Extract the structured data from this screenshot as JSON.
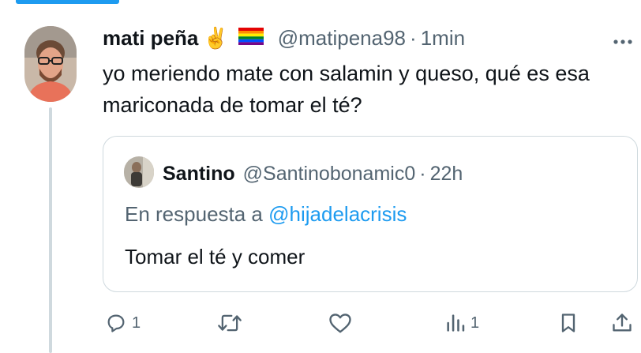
{
  "tweet": {
    "display_name": "mati peña",
    "emoji_hand": "✌️",
    "emoji_flag": "rainbow-flag",
    "handle": "@matipena98",
    "separator": "·",
    "time": "1min",
    "text": "yo meriendo mate con salamin y queso, qué es esa mariconada de tomar el té?",
    "more_icon": "more-horizontal-icon"
  },
  "quote": {
    "display_name": "Santino",
    "handle": "@Santinobonamic0",
    "separator": "·",
    "time": "22h",
    "reply_prefix": "En respuesta a",
    "reply_mention": "@hijadelacrisis",
    "text": "Tomar el té y comer"
  },
  "actions": {
    "reply_count": "1",
    "views_count": "1"
  },
  "colors": {
    "accent": "#1d9bf0",
    "secondary_text": "#536471",
    "border": "#cfd9de"
  }
}
